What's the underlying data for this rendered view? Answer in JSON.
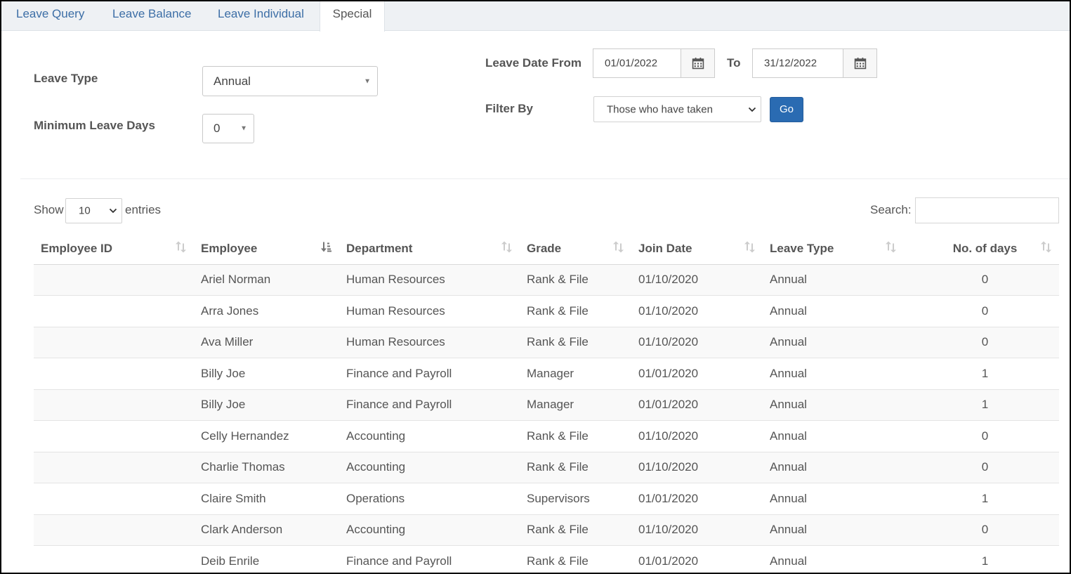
{
  "tabs": [
    {
      "label": "Leave Query"
    },
    {
      "label": "Leave Balance"
    },
    {
      "label": "Leave Individual"
    },
    {
      "label": "Special"
    }
  ],
  "form": {
    "leave_type_label": "Leave Type",
    "leave_type_value": "Annual",
    "min_days_label": "Minimum Leave Days",
    "min_days_value": "0",
    "date_from_label": "Leave Date From",
    "date_from_value": "01/01/2022",
    "to_label": "To",
    "date_to_value": "31/12/2022",
    "filter_label": "Filter By",
    "filter_value": "Those who have taken",
    "go_label": "Go"
  },
  "list_controls": {
    "show_label": "Show",
    "entries_value": "10",
    "entries_label": "entries",
    "search_label": "Search:"
  },
  "table": {
    "headers": [
      "Employee ID",
      "Employee",
      "Department",
      "Grade",
      "Join Date",
      "Leave Type",
      "No. of days"
    ],
    "rows": [
      [
        "",
        "Ariel Norman",
        "Human Resources",
        "Rank & File",
        "01/10/2020",
        "Annual",
        "0"
      ],
      [
        "",
        "Arra Jones",
        "Human Resources",
        "Rank & File",
        "01/10/2020",
        "Annual",
        "0"
      ],
      [
        "",
        "Ava Miller",
        "Human Resources",
        "Rank & File",
        "01/10/2020",
        "Annual",
        "0"
      ],
      [
        "",
        "Billy Joe",
        "Finance and Payroll",
        "Manager",
        "01/01/2020",
        "Annual",
        "1"
      ],
      [
        "",
        "Billy Joe",
        "Finance and Payroll",
        "Manager",
        "01/01/2020",
        "Annual",
        "1"
      ],
      [
        "",
        "Celly Hernandez",
        "Accounting",
        "Rank & File",
        "01/10/2020",
        "Annual",
        "0"
      ],
      [
        "",
        "Charlie Thomas",
        "Accounting",
        "Rank & File",
        "01/10/2020",
        "Annual",
        "0"
      ],
      [
        "",
        "Claire Smith",
        "Operations",
        "Supervisors",
        "01/01/2020",
        "Annual",
        "1"
      ],
      [
        "",
        "Clark Anderson",
        "Accounting",
        "Rank & File",
        "01/10/2020",
        "Annual",
        "0"
      ],
      [
        "",
        "Deib Enrile",
        "Finance and Payroll",
        "Rank & File",
        "01/01/2020",
        "Annual",
        "1"
      ]
    ]
  },
  "colors": {
    "link": "#3c6ea6",
    "primary_button": "#2a6bb2",
    "tab_bar": "#eef1f4"
  }
}
